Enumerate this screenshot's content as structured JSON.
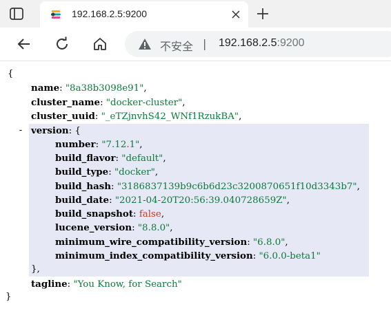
{
  "browser": {
    "tab": {
      "title": "192.168.2.5:9200"
    },
    "address": {
      "security_label": "不安全",
      "separator": "|",
      "host": "192.168.2.5",
      "port": ":9200"
    }
  },
  "json": {
    "open_brace": "{",
    "close_brace": "}",
    "name": {
      "key": "name",
      "value": "\"8a38b3098e91\""
    },
    "cluster_name": {
      "key": "cluster_name",
      "value": "\"docker-cluster\""
    },
    "cluster_uuid": {
      "key": "cluster_uuid",
      "value": "\"_eTZjnvhS42_WNf1RzukBA\""
    },
    "version": {
      "toggle": "-",
      "key": "version",
      "open": "{",
      "close": "},",
      "fields": [
        {
          "key": "number",
          "value": "\"7.12.1\"",
          "kind": "string"
        },
        {
          "key": "build_flavor",
          "value": "\"default\"",
          "kind": "string"
        },
        {
          "key": "build_type",
          "value": "\"docker\"",
          "kind": "string"
        },
        {
          "key": "build_hash",
          "value": "\"3186837139b9c6b6d23c3200870651f10d3343b7\"",
          "kind": "string"
        },
        {
          "key": "build_date",
          "value": "\"2021-04-20T20:56:39.040728659Z\"",
          "kind": "string"
        },
        {
          "key": "build_snapshot",
          "value": "false",
          "kind": "boolean"
        },
        {
          "key": "lucene_version",
          "value": "\"8.8.0\"",
          "kind": "string"
        },
        {
          "key": "minimum_wire_compatibility_version",
          "value": "\"6.8.0\"",
          "kind": "string"
        },
        {
          "key": "minimum_index_compatibility_version",
          "value": "\"6.0.0-beta1\"",
          "kind": "string"
        }
      ]
    },
    "tagline": {
      "key": "tagline",
      "value": "\"You Know, for Search\""
    }
  },
  "colors": {
    "string": "#0b7a3b",
    "boolean": "#c0392b",
    "highlight": "#e6e8f5"
  }
}
